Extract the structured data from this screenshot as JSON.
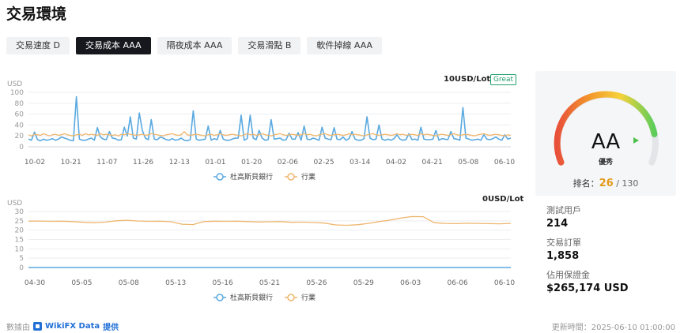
{
  "page": {
    "title": "交易環境"
  },
  "tabs": [
    {
      "label": "交易速度 D",
      "active": false
    },
    {
      "label": "交易成本 AAA",
      "active": true
    },
    {
      "label": "隔夜成本 AAA",
      "active": false
    },
    {
      "label": "交易滑點 B",
      "active": false
    },
    {
      "label": "軟件掉線 AAA",
      "active": false
    }
  ],
  "cost_chart": {
    "unit_label": "USD",
    "headline": "10USD/Lot",
    "badge": "Great",
    "legend": {
      "broker": "杜高斯貝銀行",
      "industry": "行業"
    }
  },
  "overnight_chart": {
    "unit_label": "USD",
    "headline": "0USD/Lot",
    "legend": {
      "broker": "杜高斯貝銀行",
      "industry": "行業"
    }
  },
  "gauge": {
    "rating": "AA",
    "caption": "優秀",
    "rank_label": "排名：",
    "rank_value": "26",
    "rank_total": "/ 130"
  },
  "stats": {
    "users_label": "測試用戶",
    "users_value": "214",
    "orders_label": "交易訂單",
    "orders_value": "1,858",
    "margin_label": "佔用保證金",
    "margin_value": "$265,174 USD"
  },
  "footer": {
    "source_prefix": "數據由",
    "source_name": "WikiFX Data",
    "source_suffix": "提供",
    "updated": "更新時間：2025-06-10 01:00:00"
  },
  "chart_data": [
    {
      "type": "line",
      "title": "10USD/Lot",
      "ylabel": "USD",
      "ylim": [
        0,
        100
      ],
      "yticks": [
        0,
        20,
        40,
        60,
        80,
        100
      ],
      "x": [
        "10-02",
        "10-21",
        "11-07",
        "11-26",
        "12-13",
        "01-01",
        "01-20",
        "02-06",
        "02-25",
        "03-14",
        "04-02",
        "04-21",
        "05-08",
        "06-10"
      ],
      "series": [
        {
          "name": "杜高斯貝銀行",
          "color": "#5aa9e0",
          "values": [
            14,
            12,
            27,
            13,
            11,
            14,
            12,
            13,
            15,
            12,
            14,
            18,
            16,
            14,
            12,
            11,
            92,
            14,
            12,
            12,
            14,
            16,
            12,
            35,
            18,
            14,
            13,
            28,
            16,
            15,
            12,
            13,
            36,
            20,
            55,
            16,
            14,
            62,
            30,
            16,
            13,
            50,
            14,
            13,
            18,
            16,
            13,
            12,
            15,
            12,
            13,
            16,
            12,
            11,
            13,
            66,
            14,
            12,
            13,
            14,
            38,
            12,
            15,
            13,
            30,
            14,
            12,
            12,
            14,
            16,
            16,
            58,
            12,
            15,
            58,
            16,
            13,
            30,
            16,
            12,
            13,
            50,
            14,
            15,
            16,
            12,
            13,
            25,
            14,
            14,
            26,
            12,
            38,
            14,
            13,
            16,
            14,
            12,
            36,
            16,
            14,
            13,
            35,
            14,
            13,
            18,
            12,
            15,
            28,
            14,
            12,
            12,
            15,
            55,
            16,
            13,
            14,
            40,
            14,
            12,
            14,
            12,
            15,
            22,
            14,
            12,
            13,
            24,
            13,
            14,
            12,
            36,
            14,
            13,
            13,
            14,
            30,
            12,
            15,
            14,
            13,
            28,
            15,
            14,
            12,
            72,
            16,
            14,
            12,
            13,
            14,
            12,
            22,
            14,
            13,
            15,
            18,
            14,
            12,
            22,
            14,
            16
          ]
        },
        {
          "name": "行業",
          "color": "#eeb66e",
          "values": [
            22,
            20,
            23,
            22,
            21,
            24,
            22,
            20,
            22,
            23,
            21,
            22,
            24,
            22,
            21,
            20,
            22,
            23,
            21,
            24,
            22,
            23,
            22,
            21,
            24,
            22,
            23,
            22,
            21,
            22,
            20,
            23,
            22,
            24,
            23,
            22,
            21,
            22,
            23,
            21,
            22,
            24,
            23,
            22,
            21,
            20,
            22,
            23,
            24,
            22,
            21,
            22,
            28,
            22,
            21,
            22,
            23,
            22,
            21,
            20,
            22,
            23,
            21,
            22,
            24,
            22,
            21,
            22,
            23,
            22,
            21,
            20,
            22,
            24,
            22,
            23,
            21,
            22,
            24,
            22,
            21,
            20,
            22,
            23,
            24,
            22,
            21,
            22,
            23,
            22,
            21,
            22,
            24,
            22,
            23,
            21,
            20,
            22,
            23,
            24,
            22,
            21,
            22,
            23,
            22,
            21,
            22,
            24,
            22,
            23,
            22,
            21,
            20,
            22,
            23,
            24,
            22,
            21,
            22,
            23,
            22,
            21,
            22,
            24,
            22,
            23,
            21,
            22,
            23,
            22,
            21,
            24,
            22,
            23,
            22,
            21,
            20,
            22,
            23,
            22,
            21,
            22,
            24,
            22,
            21,
            22,
            23,
            22,
            21,
            20,
            22,
            23,
            24,
            22,
            21,
            22,
            23,
            22,
            21,
            20,
            22,
            21
          ]
        }
      ],
      "grid": true,
      "legend": "bottom"
    },
    {
      "type": "line",
      "title": "0USD/Lot",
      "ylabel": "USD",
      "ylim": [
        0,
        30
      ],
      "yticks": [
        0,
        5,
        10,
        15,
        20,
        25,
        30
      ],
      "x": [
        "04-30",
        "05-05",
        "05-08",
        "05-13",
        "05-16",
        "05-21",
        "05-26",
        "05-29",
        "06-03",
        "06-06",
        "06-10"
      ],
      "series": [
        {
          "name": "杜高斯貝銀行",
          "color": "#5aa9e0",
          "values": [
            0,
            0,
            0,
            0,
            0,
            0,
            0,
            0,
            0,
            0,
            0,
            0,
            0,
            0,
            0,
            0,
            0,
            0,
            0,
            0,
            0,
            0,
            0,
            0,
            0,
            0,
            0,
            0,
            0,
            0,
            0,
            0,
            0,
            0,
            0,
            0,
            0,
            0,
            0,
            0,
            0,
            0,
            0,
            0,
            0
          ]
        },
        {
          "name": "行業",
          "color": "#eeb66e",
          "values": [
            24.8,
            24.9,
            24.7,
            24.8,
            24.6,
            24.2,
            24.0,
            24.3,
            25.0,
            25.3,
            24.9,
            24.7,
            24.8,
            24.5,
            23.2,
            23.0,
            24.6,
            24.8,
            24.7,
            24.8,
            24.6,
            24.4,
            24.5,
            24.6,
            24.2,
            24.3,
            24.1,
            23.8,
            22.8,
            22.6,
            22.9,
            23.6,
            24.6,
            25.4,
            26.5,
            27.3,
            27.2,
            24.0,
            23.6,
            23.5,
            23.7,
            23.6,
            23.5,
            23.4,
            23.6
          ]
        }
      ],
      "grid": true,
      "legend": "bottom"
    }
  ]
}
